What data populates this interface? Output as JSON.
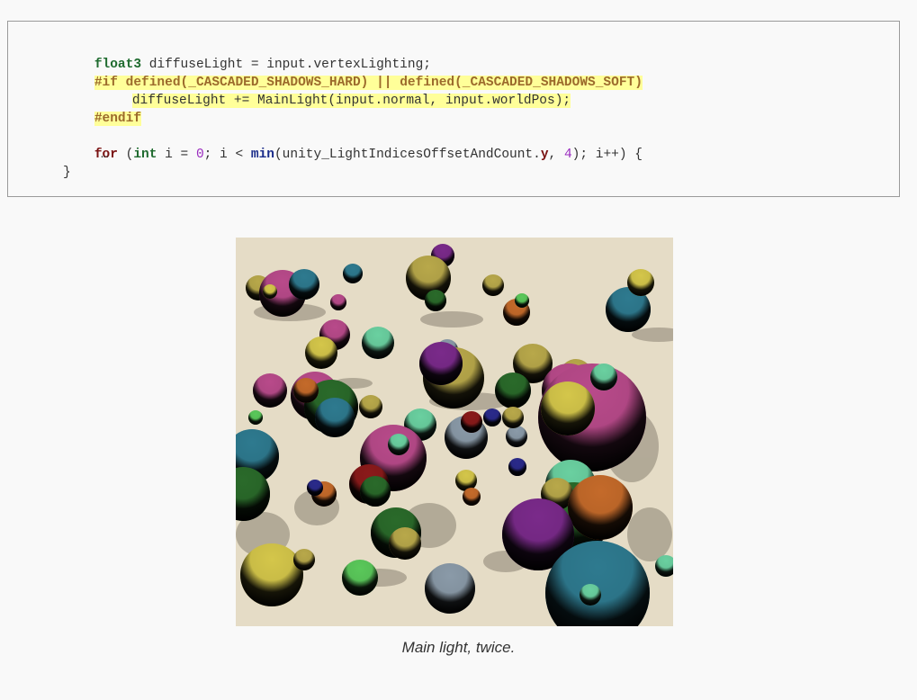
{
  "code": {
    "line1": {
      "type": "float3",
      "rest": " diffuseLight = input.vertexLighting;"
    },
    "line2": {
      "if": "#if",
      "mid1": " ",
      "defined1": "defined",
      "arg1": "(_CASCADED_SHADOWS_HARD) || ",
      "defined2": "defined",
      "arg2": "(_CASCADED_SHADOWS_SOFT)"
    },
    "line3": {
      "text": "diffuseLight += MainLight(input.normal, input.worldPos);"
    },
    "line4": {
      "endif": "#endif"
    },
    "line6": {
      "for": "for",
      "open": " (",
      "int": "int",
      "a": " i = ",
      "zero": "0",
      "b": "; i < ",
      "min": "min",
      "c": "(unity_LightIndicesOffsetAndCount.",
      "y": "y",
      "d": ", ",
      "four": "4",
      "e": "); i++) {"
    },
    "line7": {
      "text": "…"
    },
    "line8": {
      "text": "}"
    }
  },
  "figure": {
    "caption": "Main light, twice.",
    "background_color": "#e5dcc6",
    "sphere_colors": [
      "#2e7a8f",
      "#b84a8a",
      "#d4c64a",
      "#7a2a8a",
      "#c46a2a",
      "#5ac85a",
      "#8a9aa8",
      "#2a6a2a",
      "#6ad0a0",
      "#8a1a1a",
      "#2a2a8a",
      "#b8a84a"
    ]
  }
}
